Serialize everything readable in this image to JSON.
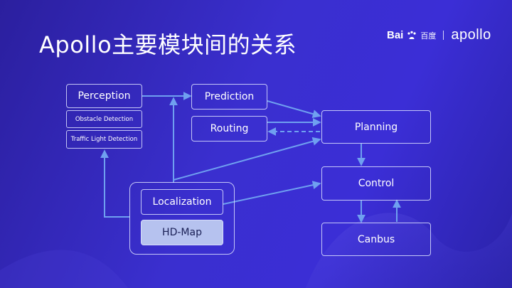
{
  "slide": {
    "title": "Apollo主要模块间的关系",
    "logo": {
      "baidu_latin": "Bai",
      "baidu_chinese": "百度",
      "product": "apollo"
    }
  },
  "diagram": {
    "nodes": {
      "perception": "Perception",
      "obstacle_detection": "Obstacle Detection",
      "traffic_light_detection": "Traffic Light Detection",
      "prediction": "Prediction",
      "routing": "Routing",
      "planning": "Planning",
      "control": "Control",
      "localization": "Localization",
      "hd_map": "HD-Map",
      "canbus": "Canbus"
    }
  },
  "colors": {
    "background_start": "#2b1f9e",
    "background_end": "#3b2ed6",
    "line": "#6fa0f0",
    "box_border": "#dce1ff",
    "hd_map_fill": "#b6c2ef"
  }
}
